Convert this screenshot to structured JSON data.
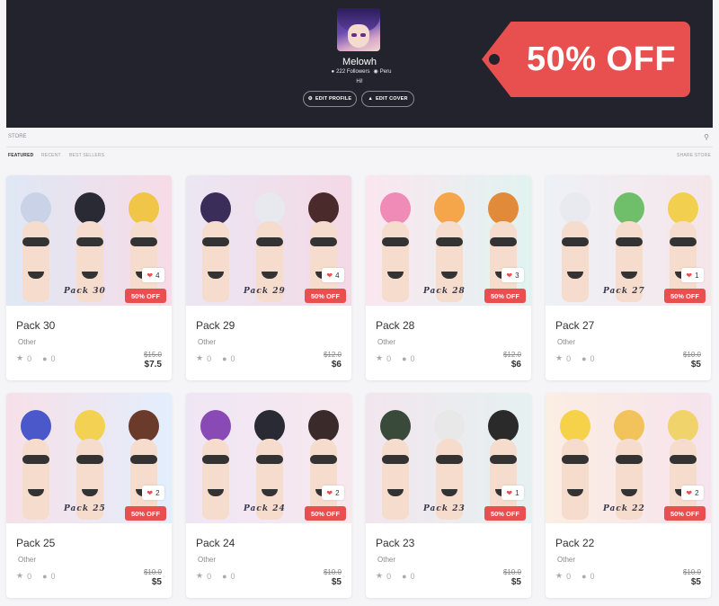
{
  "profile": {
    "name": "Melowh",
    "followers": "222 Followers",
    "location": "Peru",
    "bio": "Hi!",
    "edit_profile": "EDIT PROFILE",
    "edit_cover": "EDIT COVER",
    "promo": "50% OFF"
  },
  "store": {
    "label": "STORE",
    "tabs": [
      "FEATURED",
      "RECENT",
      "BEST SELLERS"
    ],
    "share": "SHARE STORE"
  },
  "cards": [
    {
      "title": "Pack 30",
      "pack": "Pack 30",
      "category": "Other",
      "likes": "4",
      "badge": "50% OFF",
      "stars": "0",
      "comments": "0",
      "old_price": "$15.0",
      "price": "$7.5"
    },
    {
      "title": "Pack 29",
      "pack": "Pack 29",
      "category": "Other",
      "likes": "4",
      "badge": "50% OFF",
      "stars": "0",
      "comments": "0",
      "old_price": "$12.0",
      "price": "$6"
    },
    {
      "title": "Pack 28",
      "pack": "Pack 28",
      "category": "Other",
      "likes": "3",
      "badge": "50% OFF",
      "stars": "0",
      "comments": "0",
      "old_price": "$12.0",
      "price": "$6"
    },
    {
      "title": "Pack 27",
      "pack": "Pack 27",
      "category": "Other",
      "likes": "1",
      "badge": "50% OFF",
      "stars": "0",
      "comments": "0",
      "old_price": "$10.0",
      "price": "$5"
    },
    {
      "title": "Pack 25",
      "pack": "Pack 25",
      "category": "Other",
      "likes": "2",
      "badge": "50% OFF",
      "stars": "0",
      "comments": "0",
      "old_price": "$10.0",
      "price": "$5"
    },
    {
      "title": "Pack 24",
      "pack": "Pack 24",
      "category": "Other",
      "likes": "2",
      "badge": "50% OFF",
      "stars": "0",
      "comments": "0",
      "old_price": "$10.0",
      "price": "$5"
    },
    {
      "title": "Pack 23",
      "pack": "Pack 23",
      "category": "Other",
      "likes": "1",
      "badge": "50% OFF",
      "stars": "0",
      "comments": "0",
      "old_price": "$10.0",
      "price": "$5"
    },
    {
      "title": "Pack 22",
      "pack": "Pack 22",
      "category": "Other",
      "likes": "2",
      "badge": "50% OFF",
      "stars": "0",
      "comments": "0",
      "old_price": "$10.0",
      "price": "$5"
    }
  ],
  "colors": {
    "header_bg": "#23232d",
    "accent": "#e84f4f",
    "page_bg": "#f5f5f7"
  },
  "icons": {
    "followers": "user-icon",
    "location": "pin-icon",
    "edit_profile": "gear-icon",
    "edit_cover": "mountain-icon",
    "search": "search-icon",
    "likes": "heart-icon",
    "stars": "star-icon",
    "comments": "comment-icon"
  }
}
